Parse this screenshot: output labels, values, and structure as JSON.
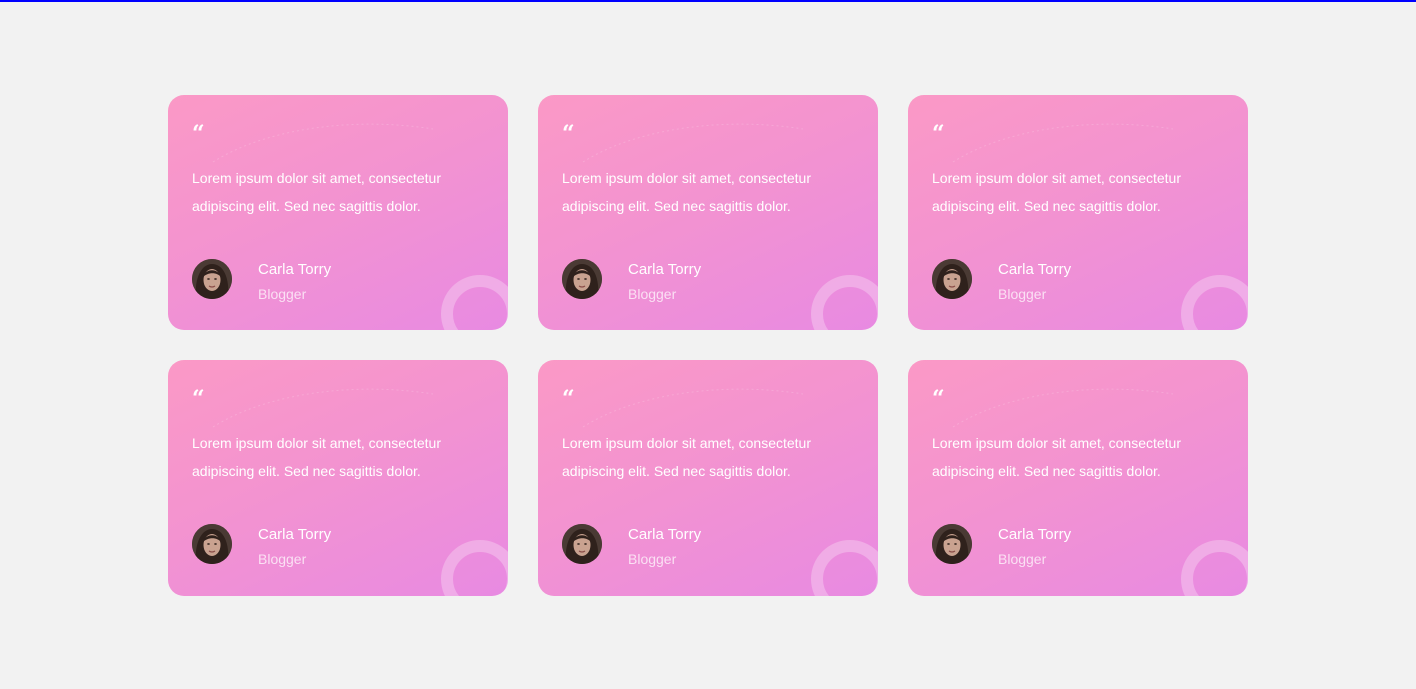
{
  "testimonials": [
    {
      "quote_mark": "“",
      "text": "Lorem ipsum dolor sit amet, consectetur adipiscing elit. Sed nec sagittis dolor.",
      "author": "Carla Torry",
      "role": "Blogger"
    },
    {
      "quote_mark": "“",
      "text": "Lorem ipsum dolor sit amet, consectetur adipiscing elit. Sed nec sagittis dolor.",
      "author": "Carla Torry",
      "role": "Blogger"
    },
    {
      "quote_mark": "“",
      "text": "Lorem ipsum dolor sit amet, consectetur adipiscing elit. Sed nec sagittis dolor.",
      "author": "Carla Torry",
      "role": "Blogger"
    },
    {
      "quote_mark": "“",
      "text": "Lorem ipsum dolor sit amet, consectetur adipiscing elit. Sed nec sagittis dolor.",
      "author": "Carla Torry",
      "role": "Blogger"
    },
    {
      "quote_mark": "“",
      "text": "Lorem ipsum dolor sit amet, consectetur adipiscing elit. Sed nec sagittis dolor.",
      "author": "Carla Torry",
      "role": "Blogger"
    },
    {
      "quote_mark": "“",
      "text": "Lorem ipsum dolor sit amet, consectetur adipiscing elit. Sed nec sagittis dolor.",
      "author": "Carla Torry",
      "role": "Blogger"
    }
  ],
  "colors": {
    "page_background": "#f2f2f2",
    "top_border": "#0000ff",
    "card_gradient_start": "#fb99c6",
    "card_gradient_end": "#e88ae2",
    "text": "#ffffff"
  },
  "icons": {
    "quote": "quote-icon",
    "avatar": "avatar",
    "decoration": "circle-decoration"
  }
}
